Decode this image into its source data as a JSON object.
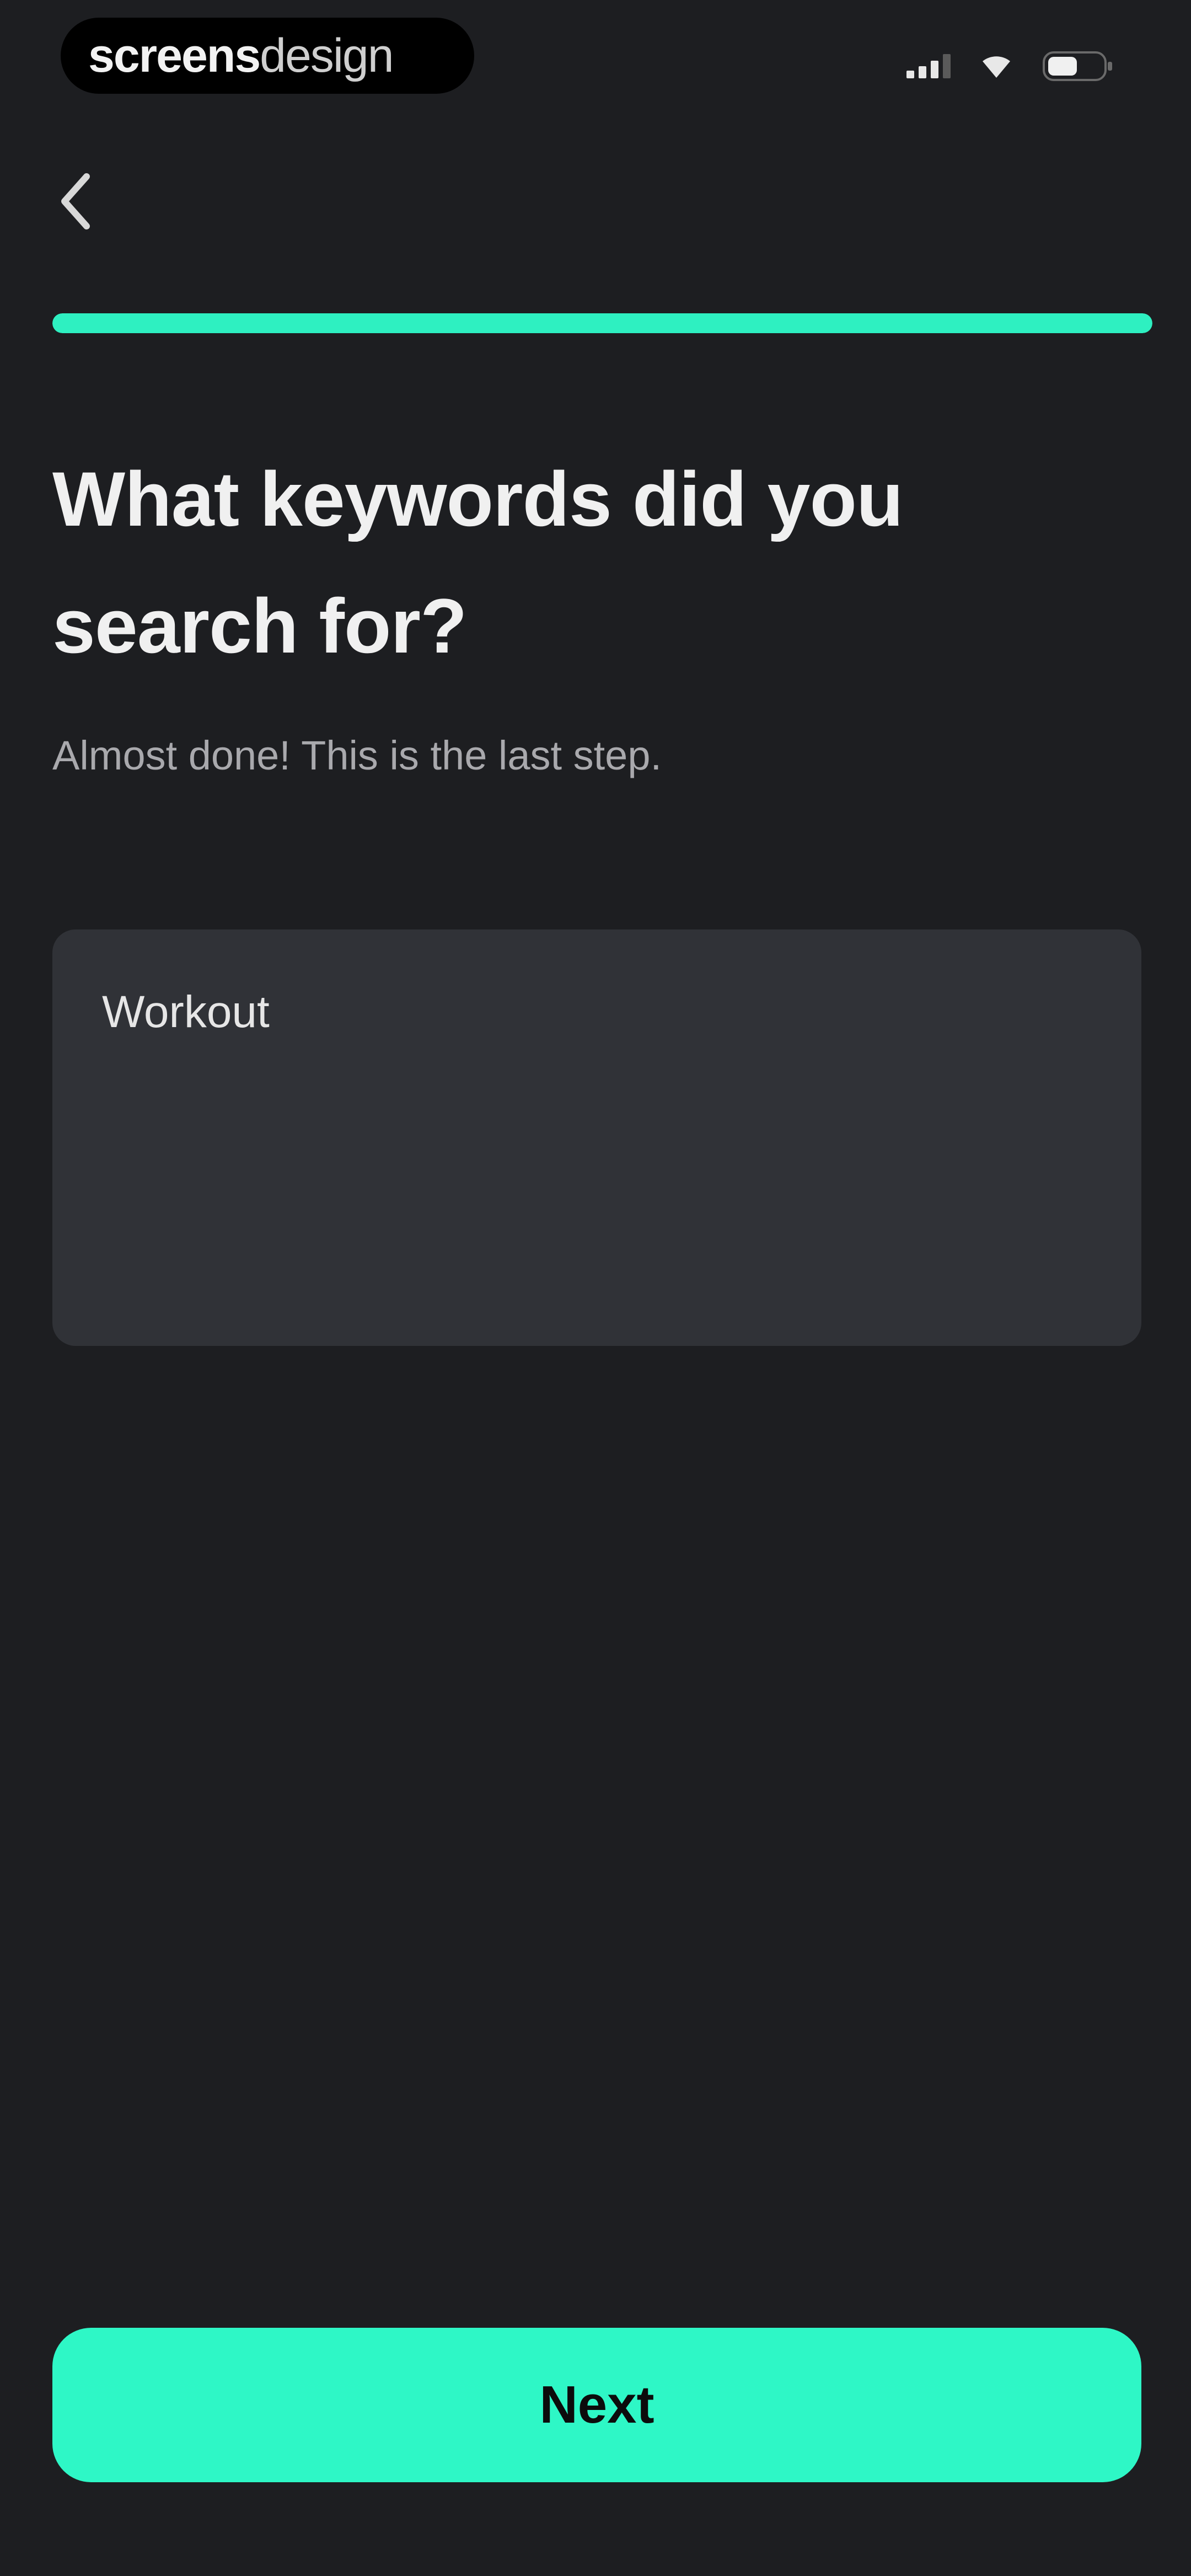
{
  "status_bar": {
    "brand_strong": "screens",
    "brand_light": "design",
    "icons": [
      "cellular-signal-icon",
      "wifi-icon",
      "battery-icon"
    ]
  },
  "nav": {
    "back_icon": "chevron-left-icon"
  },
  "progress": {
    "fraction": 1.0
  },
  "content": {
    "title": "What keywords did you search for?",
    "subtitle": "Almost done! This is the last step.",
    "keywords_value": "Workout"
  },
  "footer": {
    "next_label": "Next"
  },
  "colors": {
    "background": "#1d1e21",
    "accent": "#2ef0c1",
    "input_bg": "#303237"
  }
}
